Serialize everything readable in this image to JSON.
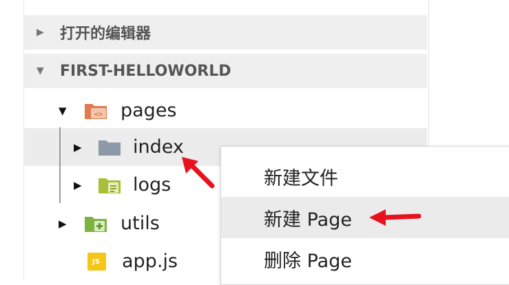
{
  "explorer": {
    "sections": [
      {
        "label": "打开的编辑器",
        "expanded": false
      },
      {
        "label": "FIRST-HELLOWORLD",
        "expanded": true
      }
    ],
    "tree": [
      {
        "label": "pages",
        "icon": "pages-folder-icon",
        "expanded": true
      },
      {
        "label": "index",
        "icon": "folder-icon",
        "expanded": false,
        "selected": true
      },
      {
        "label": "logs",
        "icon": "logs-folder-icon",
        "expanded": false
      },
      {
        "label": "utils",
        "icon": "utils-folder-icon",
        "expanded": false
      },
      {
        "label": "app.js",
        "icon": "js-file-icon",
        "badge": "JS"
      }
    ]
  },
  "context_menu": {
    "items": [
      {
        "label": "新建文件"
      },
      {
        "label": "新建 Page",
        "highlighted": true
      },
      {
        "label": "删除 Page"
      }
    ]
  },
  "colors": {
    "accent_arrow": "#e8121f",
    "section_bg": "#efefef",
    "selected_bg": "#ececec"
  }
}
